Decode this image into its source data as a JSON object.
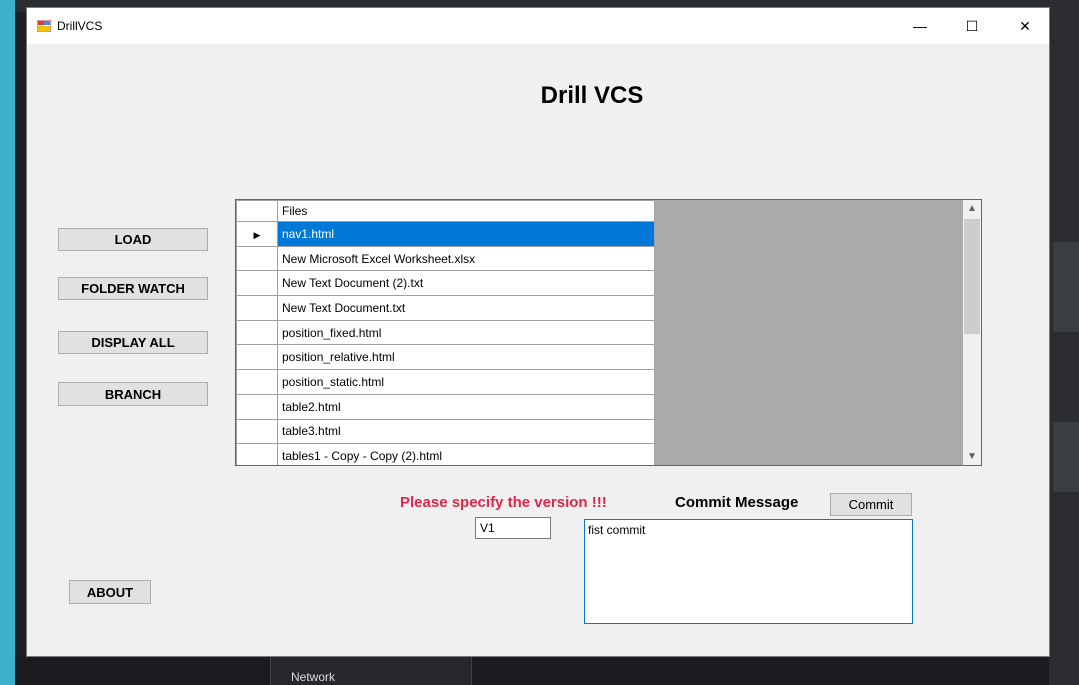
{
  "window": {
    "title": "DrillVCS",
    "minimize": "—",
    "maximize": "☐",
    "close": "✕"
  },
  "heading": "Drill VCS",
  "sidebar": {
    "load": "LOAD",
    "folder_watch": "FOLDER WATCH",
    "display_all": "DISPLAY ALL",
    "branch": "BRANCH",
    "about": "ABOUT"
  },
  "grid": {
    "column_header": "Files",
    "row_indicator": "▶",
    "selected_index": 0,
    "rows": [
      "nav1.html",
      "New Microsoft Excel Worksheet.xlsx",
      "New Text Document (2).txt",
      "New Text Document.txt",
      "position_fixed.html",
      "position_relative.html",
      "position_static.html",
      "table2.html",
      "table3.html",
      "tables1 - Copy - Copy (2).html"
    ],
    "scroll_up": "▲",
    "scroll_down": "▼"
  },
  "commit": {
    "warning": "Please specify the version !!!",
    "label": "Commit Message",
    "button": "Commit",
    "version_value": "V1",
    "message_value": "fist commit"
  },
  "taskbar": {
    "item": "Network"
  },
  "colors": {
    "accent": "#0078d7",
    "warning": "#e0264a"
  }
}
